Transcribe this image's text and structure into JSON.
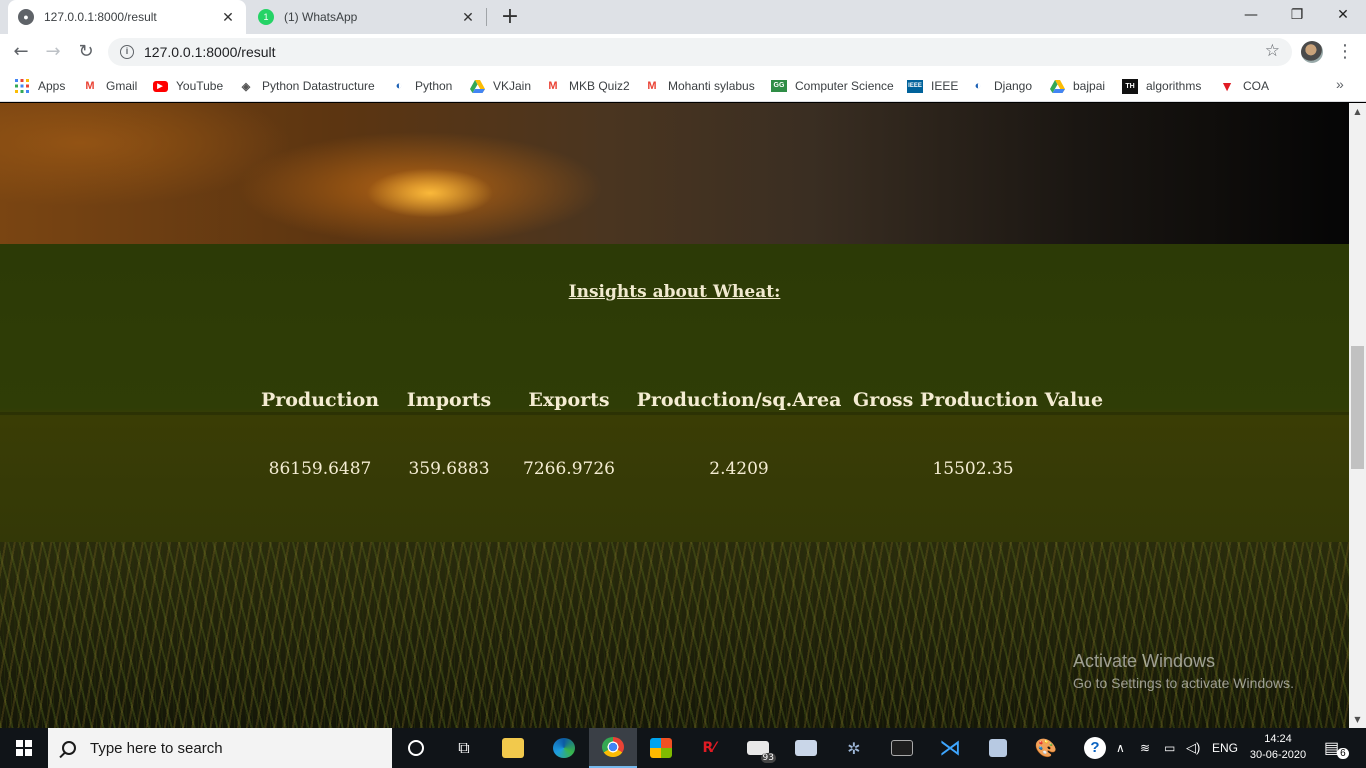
{
  "browser": {
    "tabs": [
      {
        "title": "127.0.0.1:8000/result",
        "active": true
      },
      {
        "title": "(1) WhatsApp",
        "active": false,
        "badge": "1"
      }
    ],
    "url": "127.0.0.1:8000/result",
    "bookmarks": [
      {
        "label": "Apps",
        "icon": "apps-grid-icon"
      },
      {
        "label": "Gmail",
        "icon": "gmail-icon"
      },
      {
        "label": "YouTube",
        "icon": "youtube-icon"
      },
      {
        "label": "Python Datastructure",
        "icon": "diamond-icon"
      },
      {
        "label": "Python",
        "icon": "globe-swirl-icon"
      },
      {
        "label": "VKJain",
        "icon": "google-drive-icon"
      },
      {
        "label": "MKB Quiz2",
        "icon": "gmail-icon"
      },
      {
        "label": "Mohanti sylabus",
        "icon": "gmail-icon"
      },
      {
        "label": "Computer Science",
        "icon": "geeks-icon"
      },
      {
        "label": "IEEE",
        "icon": "ieee-icon"
      },
      {
        "label": "Django",
        "icon": "globe-swirl-icon"
      },
      {
        "label": "bajpai",
        "icon": "google-drive-icon"
      },
      {
        "label": "algorithms",
        "icon": "th-icon"
      },
      {
        "label": "COA",
        "icon": "red-v-icon"
      }
    ],
    "more_bookmarks": "»"
  },
  "page": {
    "title": "Insights about Wheat:",
    "headers": [
      "Production",
      "Imports",
      "Exports",
      "Production/sq.Area",
      "Gross Production Value"
    ],
    "values": [
      "86159.6487",
      "359.6883",
      "7266.9726",
      "2.4209",
      "15502.35"
    ]
  },
  "watermark": {
    "line1": "Activate Windows",
    "line2": "Go to Settings to activate Windows."
  },
  "taskbar": {
    "search_placeholder": "Type here to search",
    "mail_badge": "93",
    "language": "ENG",
    "time": "14:24",
    "date": "30-06-2020",
    "notifications": "6"
  }
}
